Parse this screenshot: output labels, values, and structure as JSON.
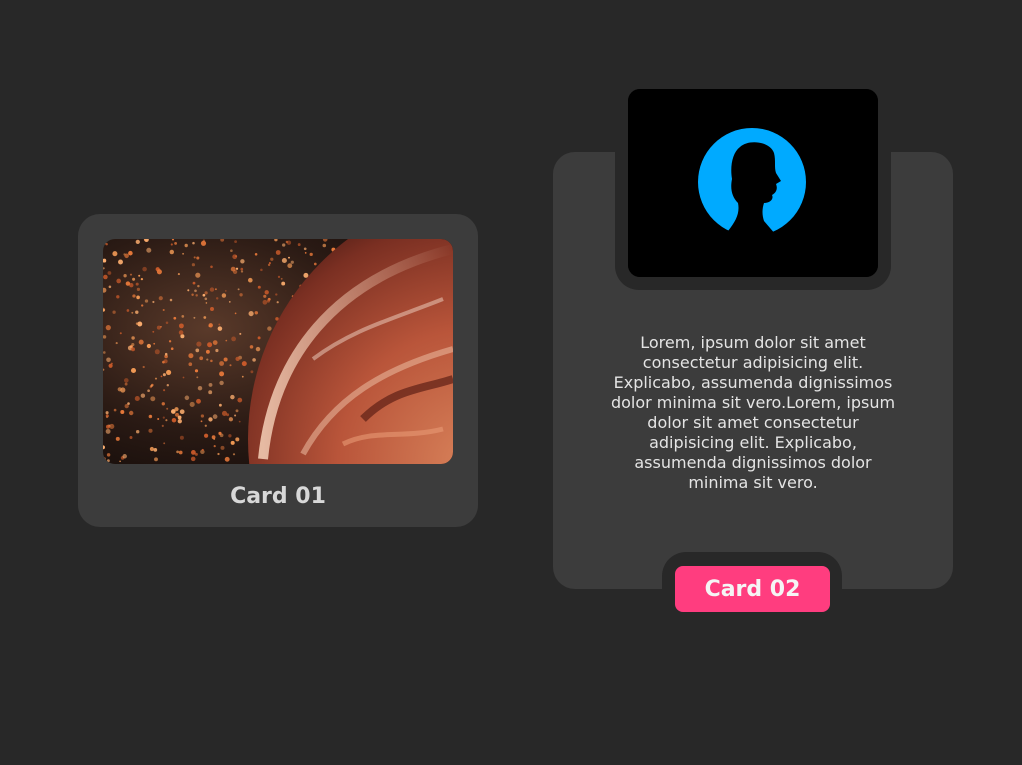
{
  "cards": [
    {
      "title": "Card 01",
      "image": "planet-particles-image"
    },
    {
      "title": "Card 02",
      "image": "user-silhouette-icon",
      "text": "Lorem, ipsum dolor sit amet consectetur adipisicing elit. Explicabo, assumenda dignissimos dolor minima sit vero.Lorem, ipsum dolor sit amet consectetur adipisicing elit. Explicabo, assumenda dignissimos dolor minima sit vero.",
      "button_label": "Card 02"
    }
  ],
  "colors": {
    "background": "#282828",
    "card": "#3c3c3c",
    "accent": "#ff3d7f",
    "avatar_circle": "#00aaff"
  }
}
